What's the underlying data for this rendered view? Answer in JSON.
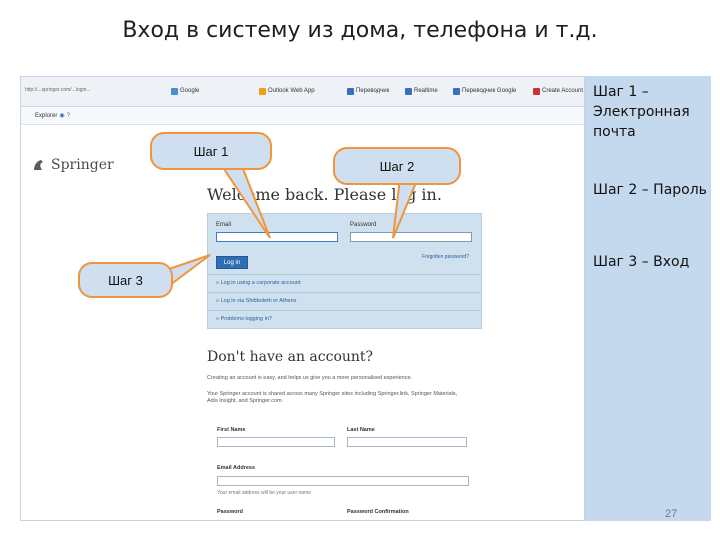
{
  "slide": {
    "title": "Вход в систему из дома, телефона и т.д.",
    "page_number": "27"
  },
  "browser": {
    "url": "http://...springer.com/...login...",
    "bookmarks": [
      {
        "label": "Google",
        "color": "#4a8fd6",
        "icon": "google-icon"
      },
      {
        "label": "Outlook Web App",
        "color": "#e8a317",
        "icon": "outlook-icon"
      },
      {
        "label": "Переводчик",
        "color": "#3a6fc0",
        "icon": "translate-icon"
      },
      {
        "label": "Realtime",
        "color": "#3a6fc0",
        "icon": "bookmark-icon"
      },
      {
        "label": "Переводчик Google",
        "color": "#3a6fc0",
        "icon": "google-translate-icon"
      },
      {
        "label": "Create Account",
        "color": "#cc3333",
        "icon": "account-icon"
      }
    ],
    "toolbar_label": "Explorer"
  },
  "page": {
    "logo": "Springer",
    "welcome": "Welcome back. Please log in.",
    "email_label": "Email",
    "password_label": "Password",
    "login_button": "Log in",
    "forgot": "Forgotten password?",
    "links": [
      "» Log in using a corporate account",
      "» Log in via Shibboleth or Athens",
      "» Problems logging in?"
    ],
    "no_account": "Don't have an account?",
    "para1": "Creating an account is easy, and helps us give you a more personalised experience.",
    "para2": "Your Springer account is shared across many Springer sites including Springer.link, Springer Materials, Adis Insight, and Springer.com.",
    "first_name": "First Name",
    "last_name": "Last Name",
    "email_address": "Email Address",
    "email_hint": "Your email address will be your user name",
    "password": "Password",
    "password_confirm": "Password Confirmation"
  },
  "callouts": {
    "step1": "Шаг 1",
    "step2": "Шаг 2",
    "step3": "Шаг 3"
  },
  "steps_panel": {
    "step1": "Шаг 1 – Электронная почта",
    "step2": "Шаг 2 – Пароль",
    "step3": "Шаг 3 – Вход"
  },
  "colors": {
    "callout_border": "#f0953a",
    "callout_fill": "#cfdff0",
    "panel": "#c5d9ee",
    "login_button": "#2f6eb3"
  }
}
